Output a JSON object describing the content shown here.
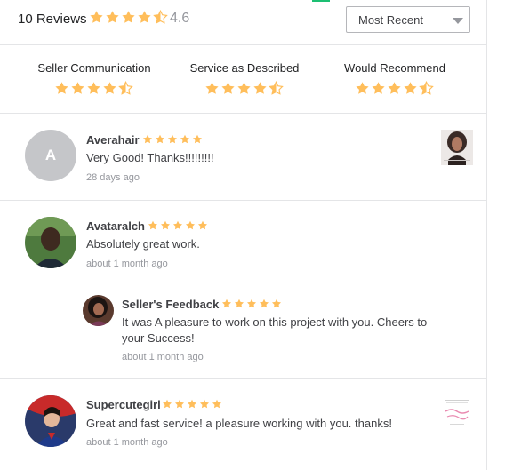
{
  "header": {
    "reviews_count": "10 Reviews",
    "rating": "4.6",
    "stars": [
      1,
      1,
      1,
      1,
      0.5
    ],
    "sort": {
      "selected": "Most Recent"
    }
  },
  "breakdown": [
    {
      "label": "Seller Communication",
      "stars": [
        1,
        1,
        1,
        1,
        0.5
      ]
    },
    {
      "label": "Service as Described",
      "stars": [
        1,
        1,
        1,
        1,
        0.5
      ]
    },
    {
      "label": "Would Recommend",
      "stars": [
        1,
        1,
        1,
        1,
        0.5
      ]
    }
  ],
  "reviews": [
    {
      "avatar_letter": "A",
      "name": "Averahair",
      "stars": 5,
      "text": "Very Good! Thanks!!!!!!!!!",
      "time": "28 days ago"
    },
    {
      "name": "Avataralch",
      "stars": 5,
      "text": "Absolutely great work.",
      "time": "about 1 month ago",
      "seller_feedback": {
        "name": "Seller's Feedback",
        "stars": 5,
        "text": "It was A pleasure to work on this project with you. Cheers to your Success!",
        "time": "about 1 month ago"
      }
    },
    {
      "name": "Supercutegirl",
      "stars": 5,
      "text": "Great and fast service! a pleasure working with you. thanks!",
      "time": "about 1 month ago"
    }
  ],
  "colors": {
    "star": "#ffbe5b",
    "accent_green": "#1dbf73",
    "divider": "#e4e5e7",
    "muted_text": "#95979d"
  }
}
